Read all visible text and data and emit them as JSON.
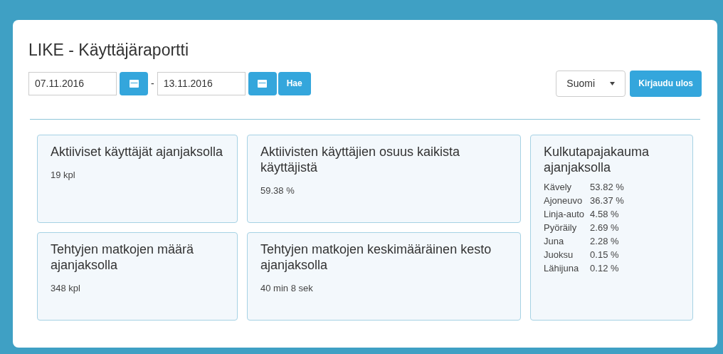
{
  "title": "LIKE - Käyttäjäraportti",
  "start_date": {
    "value": "07.11.2016"
  },
  "separator": "-",
  "end_date": {
    "value": "13.11.2016"
  },
  "search_button": "Hae",
  "language_select": {
    "value": "Suomi"
  },
  "logout_button": "Kirjaudu ulos",
  "cards": [
    {
      "title": "Aktiiviset käyttäjät ajanjaksolla",
      "value": "19 kpl"
    },
    {
      "title": "Aktiivisten käyttäjien osuus kaikista käyttäjistä",
      "value": "59.38 %"
    },
    {
      "title": "Tehtyjen matkojen määrä ajanjaksolla",
      "value": "348 kpl"
    },
    {
      "title": "Tehtyjen matkojen keskimääräinen kesto ajanjaksolla",
      "value": "40 min 8 sek"
    }
  ],
  "distribution": {
    "title": "Kulkutapajakauma ajanjaksolla",
    "rows": [
      {
        "mode": "Kävely",
        "share": "53.82 %"
      },
      {
        "mode": "Ajoneuvo",
        "share": "36.37 %"
      },
      {
        "mode": "Linja-auto",
        "share": "4.58 %"
      },
      {
        "mode": "Pyöräily",
        "share": "2.69 %"
      },
      {
        "mode": "Juna",
        "share": "2.28 %"
      },
      {
        "mode": "Juoksu",
        "share": "0.15 %"
      },
      {
        "mode": "Lähijuna",
        "share": "0.12 %"
      }
    ]
  }
}
